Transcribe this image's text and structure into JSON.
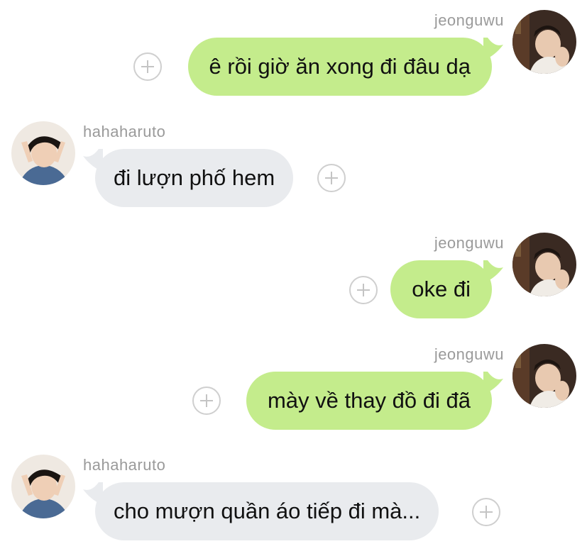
{
  "conversation": {
    "messages": [
      {
        "sender": "jeonguwu",
        "side": "right",
        "text": "ê rồi giờ ăn xong đi đâu dạ"
      },
      {
        "sender": "hahaharuto",
        "side": "left",
        "text": "đi lượn phố hem"
      },
      {
        "sender": "jeonguwu",
        "side": "right",
        "text": "oke đi"
      },
      {
        "sender": "jeonguwu",
        "side": "right",
        "text": "mày về thay đồ đi đã"
      },
      {
        "sender": "hahaharuto",
        "side": "left",
        "text": "cho mượn quần áo tiếp đi mà..."
      }
    ]
  },
  "colors": {
    "outgoing_bubble": "#c4ec8c",
    "incoming_bubble": "#e9ebee",
    "sender_name": "#9a9a9a",
    "message_text": "#111111",
    "add_reaction_icon": "#c4c4c4"
  },
  "icons": {
    "add_reaction": "plus-circle-icon"
  }
}
